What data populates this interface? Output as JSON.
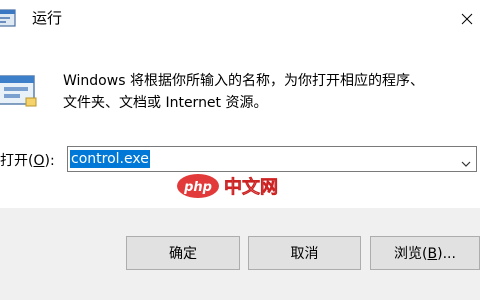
{
  "window": {
    "title": "运行",
    "close_icon": "close-icon",
    "app_icon": "run-app-icon"
  },
  "content": {
    "description_line1": "Windows 将根据你所输入的名称，为你打开相应的程序、",
    "description_line2": "文件夹、文档或 Internet 资源。",
    "open_label_prefix": "打开(",
    "open_label_key": "O",
    "open_label_suffix": "):",
    "input_value": "control.exe",
    "dropdown_icon": "chevron-down-icon"
  },
  "watermark": {
    "brand": "php",
    "text": "中文网"
  },
  "buttons": {
    "ok_label": "确定",
    "cancel_label": "取消",
    "browse_prefix": "浏览(",
    "browse_key": "B",
    "browse_suffix": ")..."
  },
  "colors": {
    "selection": "#0078d7",
    "footer_bg": "#f0f0f0",
    "button_bg": "#e1e1e1",
    "watermark_red": "#cc2222"
  }
}
